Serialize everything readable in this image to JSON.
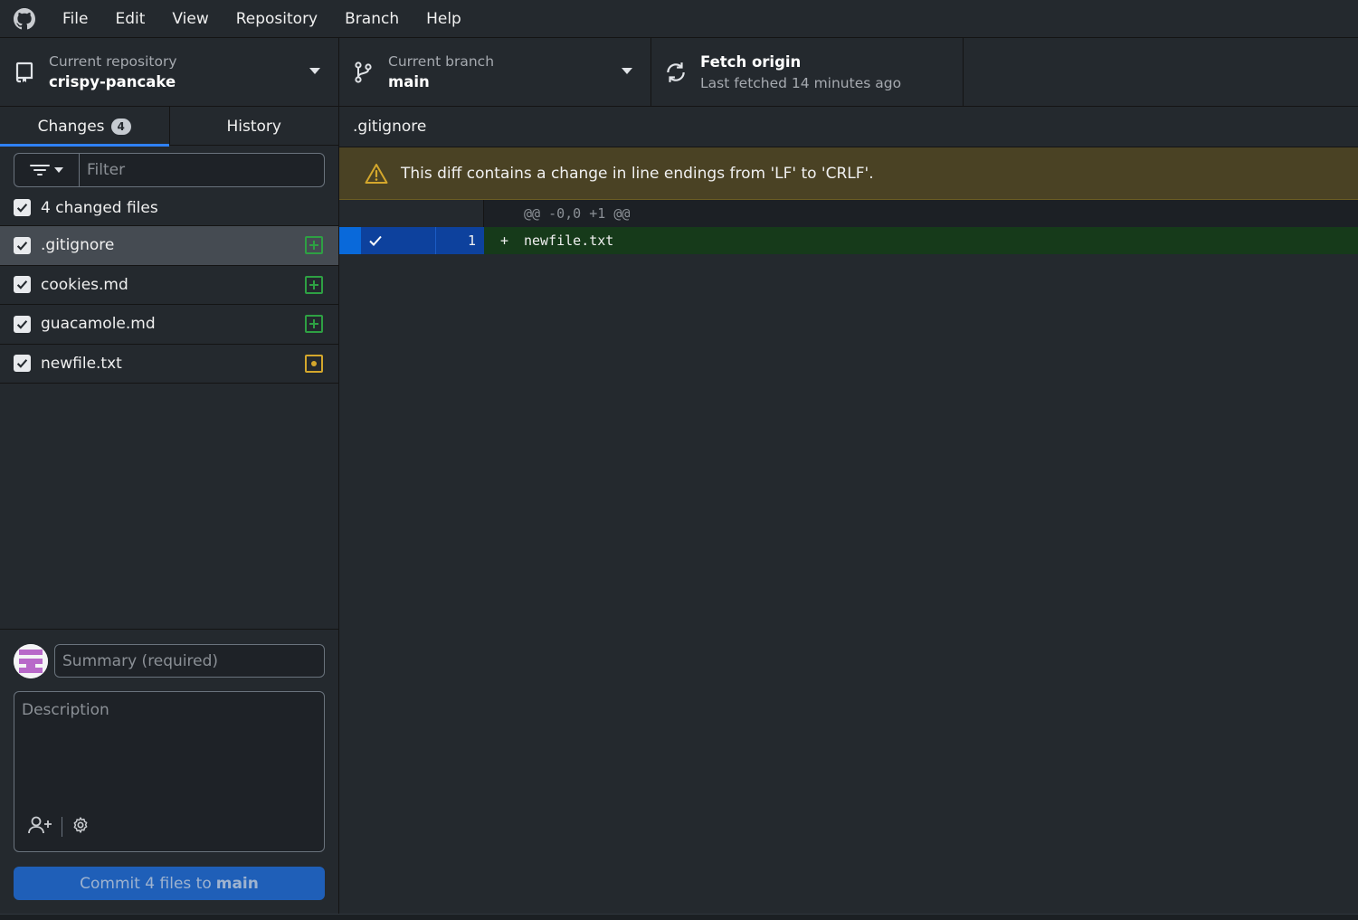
{
  "menu": {
    "items": [
      {
        "label": "File"
      },
      {
        "label": "Edit"
      },
      {
        "label": "View"
      },
      {
        "label": "Repository"
      },
      {
        "label": "Branch"
      },
      {
        "label": "Help"
      }
    ]
  },
  "toolbar": {
    "repository": {
      "label": "Current repository",
      "value": "crispy-pancake"
    },
    "branch": {
      "label": "Current branch",
      "value": "main"
    },
    "fetch": {
      "label": "Fetch origin",
      "status": "Last fetched 14 minutes ago"
    }
  },
  "sidebar": {
    "tabs": {
      "changes": {
        "label": "Changes",
        "count": "4"
      },
      "history": {
        "label": "History"
      }
    },
    "filter": {
      "placeholder": "Filter"
    },
    "changed_files_label": "4 changed files",
    "files": [
      {
        "name": ".gitignore",
        "status": "added",
        "checked": true,
        "selected": true
      },
      {
        "name": "cookies.md",
        "status": "added",
        "checked": true,
        "selected": false
      },
      {
        "name": "guacamole.md",
        "status": "added",
        "checked": true,
        "selected": false
      },
      {
        "name": "newfile.txt",
        "status": "modified",
        "checked": true,
        "selected": false
      }
    ]
  },
  "commit": {
    "summary_placeholder": "Summary (required)",
    "description_placeholder": "Description",
    "button_prefix": "Commit 4 files to",
    "button_branch": "main"
  },
  "diff": {
    "file_name": ".gitignore",
    "warning": "This diff contains a change in line endings from 'LF' to 'CRLF'.",
    "hunk_header": "@@ -0,0 +1 @@",
    "lines": [
      {
        "number": "1",
        "prefix": "+",
        "text": "newfile.txt"
      }
    ]
  },
  "colors": {
    "background": "#24292e",
    "accent": "#2f81f7",
    "added": "#2ea043",
    "modified": "#d4a72c",
    "warning_bg": "#4a4224",
    "commit_button": "#1f5fb8"
  }
}
